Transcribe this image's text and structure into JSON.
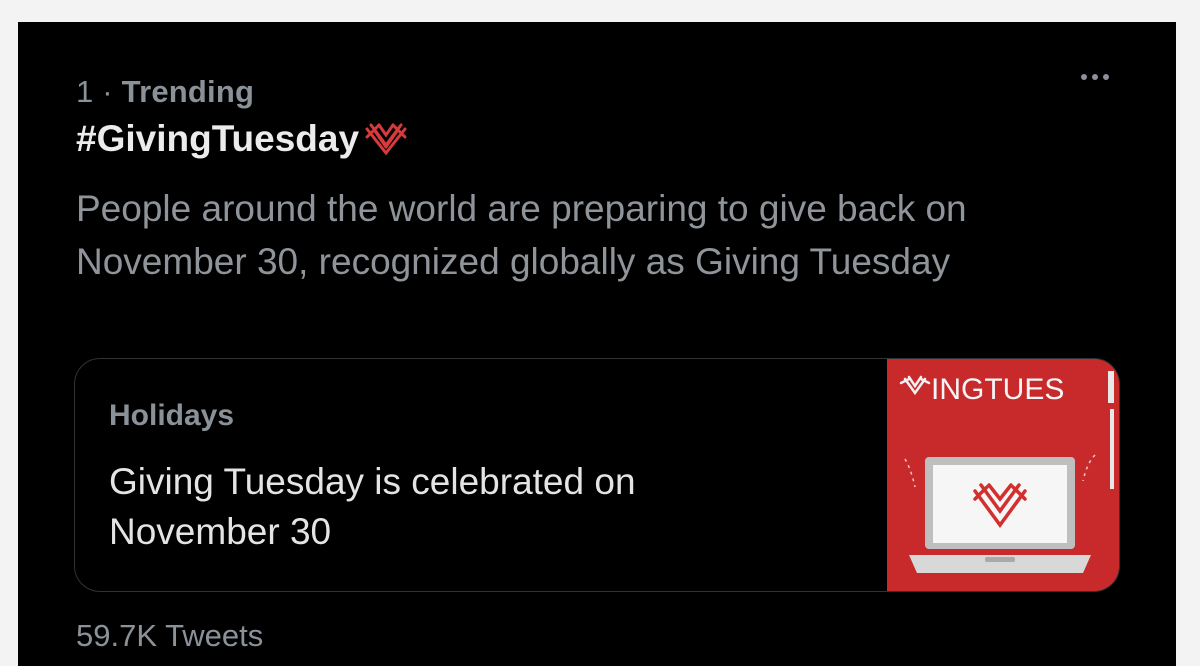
{
  "trend": {
    "rank": "1",
    "separator": "·",
    "label": "Trending",
    "topic": "#GivingTuesday",
    "description": "People around the world are preparing to give back on November 30, recognized globally as Giving Tuesday",
    "more_icon": "more-horizontal-icon",
    "topic_emoji_icon": "giving-heart-icon"
  },
  "card": {
    "category": "Holidays",
    "title": "Giving Tuesday is celebrated on November 30",
    "image_text": "INGTUES"
  },
  "footer": {
    "tweets": "59.7K Tweets"
  },
  "colors": {
    "background": "#000000",
    "text_primary": "#ececec",
    "text_secondary": "#8b9198",
    "brand_red": "#c82a2c"
  }
}
